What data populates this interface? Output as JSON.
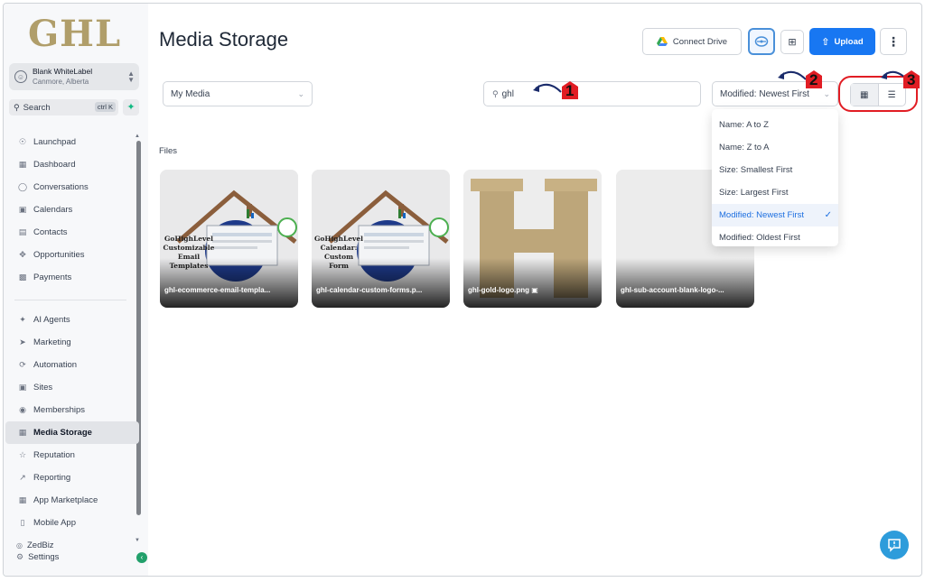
{
  "sidebar": {
    "logo": "GHL",
    "account": {
      "name": "Blank WhiteLabel",
      "location": "Canmore, Alberta"
    },
    "search": {
      "placeholder": "Search",
      "shortcut": "ctrl K"
    },
    "items_top": [
      {
        "label": "Launchpad",
        "icon": "rocket-icon"
      },
      {
        "label": "Dashboard",
        "icon": "grid-icon"
      },
      {
        "label": "Conversations",
        "icon": "chat-icon"
      },
      {
        "label": "Calendars",
        "icon": "calendar-icon"
      },
      {
        "label": "Contacts",
        "icon": "contacts-icon"
      },
      {
        "label": "Opportunities",
        "icon": "opportunities-icon"
      },
      {
        "label": "Payments",
        "icon": "payments-icon"
      }
    ],
    "items_bottom": [
      {
        "label": "AI Agents",
        "icon": "sparkle-icon"
      },
      {
        "label": "Marketing",
        "icon": "send-icon"
      },
      {
        "label": "Automation",
        "icon": "automation-icon"
      },
      {
        "label": "Sites",
        "icon": "sites-icon"
      },
      {
        "label": "Memberships",
        "icon": "award-icon"
      },
      {
        "label": "Media Storage",
        "icon": "image-icon",
        "active": true
      },
      {
        "label": "Reputation",
        "icon": "star-icon"
      },
      {
        "label": "Reporting",
        "icon": "trend-icon"
      },
      {
        "label": "App Marketplace",
        "icon": "apps-icon"
      },
      {
        "label": "Mobile App",
        "icon": "phone-icon"
      }
    ],
    "footer_line1": "ZedBiz",
    "footer_line2": "Settings"
  },
  "header": {
    "title": "Media Storage",
    "connect_drive": "Connect Drive",
    "upload": "Upload"
  },
  "toolbar": {
    "media_select": "My Media",
    "search_value": "ghl",
    "sort_select": "Modified: Newest First"
  },
  "sort_options": [
    {
      "label": "Name: A to Z",
      "selected": false
    },
    {
      "label": "Name: Z to A",
      "selected": false
    },
    {
      "label": "Size: Smallest First",
      "selected": false
    },
    {
      "label": "Size: Largest First",
      "selected": false
    },
    {
      "label": "Modified: Newest First",
      "selected": true
    },
    {
      "label": "Modified: Oldest First",
      "selected": false
    }
  ],
  "files_label": "Files",
  "files": [
    {
      "name": "ghl-ecommerce-email-templa...",
      "thumb_text": "GoHighLevel\nCustomizable\nEmail Templates"
    },
    {
      "name": "ghl-calendar-custom-forms.p...",
      "thumb_text": "GoHighLevel\nCalendar:\nCustom Form"
    },
    {
      "name": "ghl-gold-logo.png",
      "thumb_text": "H"
    },
    {
      "name": "ghl-sub-account-blank-logo-...",
      "thumb_text": ""
    }
  ],
  "callouts": [
    "1",
    "2",
    "3"
  ],
  "colors": {
    "accent": "#1877f2",
    "highlight": "#e11d24",
    "logo": "#b09e6a"
  }
}
